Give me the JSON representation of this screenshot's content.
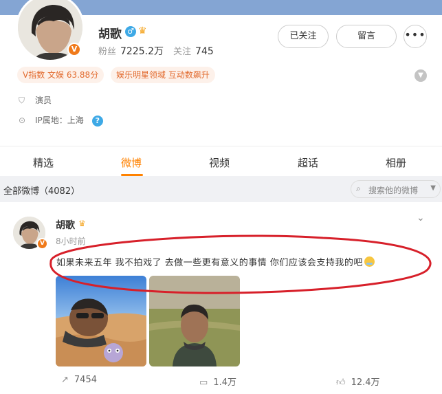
{
  "colors": {
    "accent": "#ff8200",
    "cover": "#84a5d3",
    "annotation": "#d7202a",
    "verified": "#f07a1a"
  },
  "profile": {
    "name": "胡歌",
    "verified_badge": "V",
    "gender_icon": "♂",
    "fans_label": "粉丝",
    "fans_value": "7225.2万",
    "following_label": "关注",
    "following_value": "745",
    "follow_button": "已关注",
    "message_button": "留言",
    "more_button": "•••",
    "tags": [
      "V指数 文娱 63.88分",
      "娱乐明星领域 互动数飙升"
    ],
    "occupation": "演员",
    "ip_location": "IP属地：上海",
    "help_icon": "?"
  },
  "tabs": [
    {
      "label": "精选"
    },
    {
      "label": "微博",
      "active": true
    },
    {
      "label": "视频"
    },
    {
      "label": "超话"
    },
    {
      "label": "相册"
    }
  ],
  "list_header": {
    "title": "全部微博（4082）",
    "search_placeholder": "搜索他的微博"
  },
  "post": {
    "author": "胡歌",
    "time": "8小时前",
    "text": "如果未来五年 我不拍戏了 去做一些更有意义的事情 你们应该会支持我的吧",
    "emoji": "hug-emoji",
    "reposts": "7454",
    "comments": "1.4万",
    "likes": "12.4万"
  }
}
